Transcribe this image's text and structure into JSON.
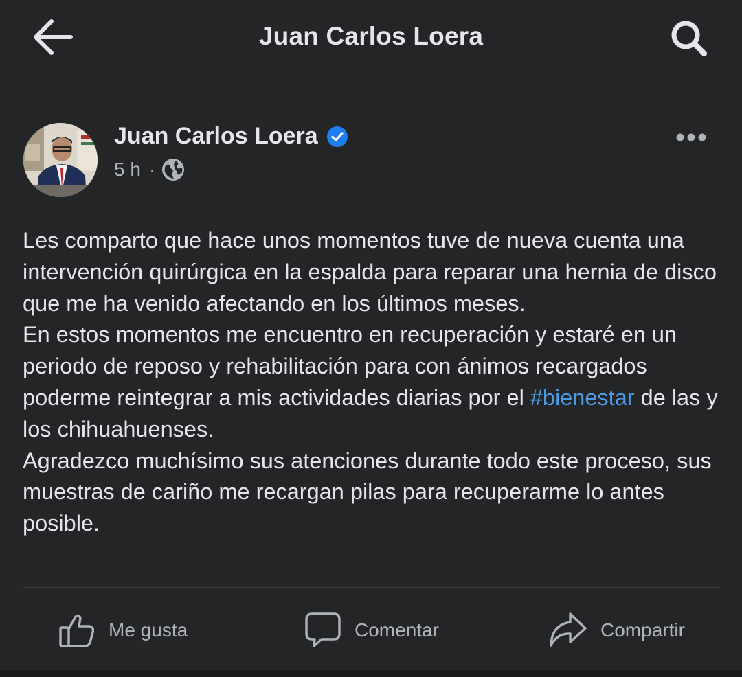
{
  "topbar": {
    "title": "Juan Carlos Loera",
    "back_icon": "arrow-left-icon",
    "search_icon": "search-icon"
  },
  "post": {
    "author": "Juan Carlos Loera",
    "verified": true,
    "time": "5 h",
    "separator": "·",
    "audience_icon": "globe-icon",
    "paragraphs": {
      "p1": "Les comparto que hace unos momentos tuve de nueva cuenta una intervención quirúrgica en la espalda para reparar una hernia de disco que me ha venido afectando en los últimos meses.",
      "p2": "En estos momentos me encuentro en recuperación y estaré en un periodo de reposo y rehabilitación para con ánimos recargados poderme reintegrar a mis actividades diarias por el",
      "hashtag": "#bienestar",
      "p2_end": "de las y los chihuahuenses.",
      "p3": "Agradezco muchísimo sus atenciones durante todo este proceso, sus muestras de cariño me recargan pilas para recuperarme lo antes posible."
    }
  },
  "actions": {
    "like": "Me gusta",
    "comment": "Comentar",
    "share": "Compartir"
  },
  "colors": {
    "background": "#242526",
    "text": "#e4e6eb",
    "secondary_text": "#b0b3b8",
    "link": "#4b9be8",
    "verified": "#1d7ff2"
  }
}
